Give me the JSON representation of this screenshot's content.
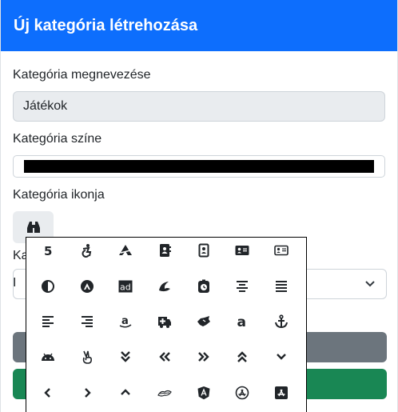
{
  "modal": {
    "title": "Új kategória létrehozása"
  },
  "form": {
    "name_label": "Kategória megnevezése",
    "name_value": "Játékok",
    "color_label": "Kategória színe",
    "color_value": "#000000",
    "icon_label": "Kategória ikonja",
    "icon_current": "binoculars-icon",
    "hidden_label_fragment": "Ka",
    "hidden_select_fragment": "I"
  },
  "colors": {
    "primary": "#0d6efd",
    "secondary": "#6c757d",
    "success": "#198754",
    "input_disabled_bg": "#e9ecef"
  },
  "icon_grid": [
    "500px-icon",
    "accessible-icon",
    "accusoft-icon",
    "address-book-icon",
    "address-book-outline-icon",
    "address-card-icon",
    "address-card-outline-icon",
    "adjust-icon",
    "adn-icon",
    "ad-icon",
    "adversal-icon",
    "alarm-clock-icon",
    "align-center-icon",
    "align-justify-icon",
    "align-left-icon",
    "align-right-icon",
    "amazon-icon",
    "ambulance-icon",
    "american-sign-language-icon",
    "amazon-a-icon",
    "anchor-icon",
    "android-icon",
    "angellist-icon",
    "angle-double-down-icon",
    "angle-double-left-icon",
    "angle-double-right-icon",
    "angle-double-up-icon",
    "angle-down-icon",
    "angle-left-icon",
    "angle-right-icon",
    "angle-up-icon",
    "angry-creative-icon",
    "angular-icon",
    "app-store-icon",
    "app-store-ios-icon"
  ]
}
